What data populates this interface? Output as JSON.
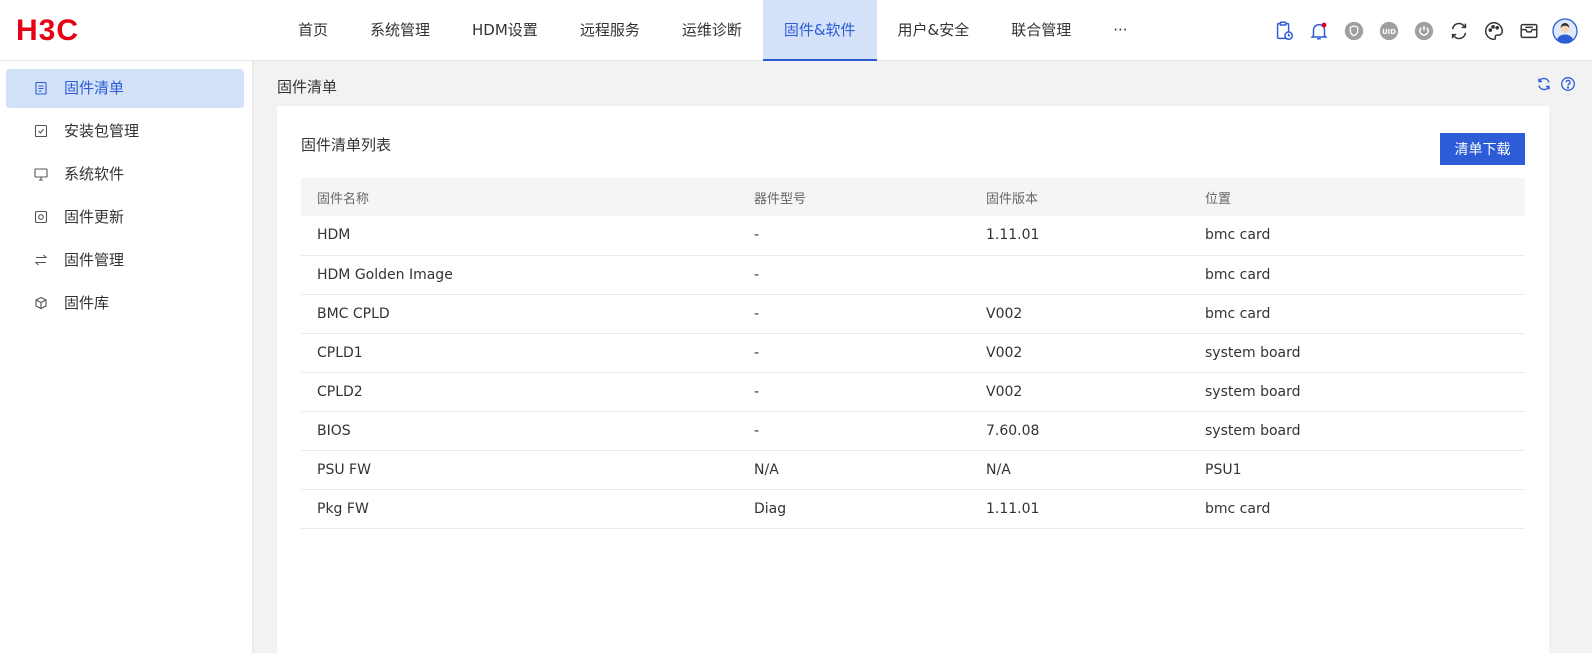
{
  "brand": {
    "logo_text": "H3C",
    "color": "#e60012",
    "accent": "#2d5cd6"
  },
  "nav": {
    "items": [
      {
        "label": "首页"
      },
      {
        "label": "系统管理"
      },
      {
        "label": "HDM设置"
      },
      {
        "label": "远程服务"
      },
      {
        "label": "运维诊断"
      },
      {
        "label": "固件&软件",
        "active": true
      },
      {
        "label": "用户&安全"
      },
      {
        "label": "联合管理"
      },
      {
        "label": "···"
      }
    ]
  },
  "header_icons": [
    "clipboard-clock-icon",
    "bell-icon",
    "shield-icon",
    "uid-icon",
    "power-icon",
    "refresh-user-icon",
    "palette-icon",
    "mail-icon",
    "avatar"
  ],
  "sidebar": {
    "items": [
      {
        "label": "固件清单",
        "icon": "clipboard-icon",
        "active": true
      },
      {
        "label": "安装包管理",
        "icon": "package-icon"
      },
      {
        "label": "系统软件",
        "icon": "monitor-icon"
      },
      {
        "label": "固件更新",
        "icon": "chip-icon"
      },
      {
        "label": "固件管理",
        "icon": "swap-icon"
      },
      {
        "label": "固件库",
        "icon": "cube-icon"
      }
    ]
  },
  "page": {
    "title": "固件清单"
  },
  "panel": {
    "title": "固件清单列表",
    "download_label": "清单下载",
    "columns": [
      "固件名称",
      "器件型号",
      "固件版本",
      "位置"
    ],
    "rows": [
      [
        "HDM",
        "-",
        "1.11.01",
        "bmc card"
      ],
      [
        "HDM Golden Image",
        "-",
        "",
        "bmc card"
      ],
      [
        "BMC CPLD",
        "-",
        "V002",
        "bmc card"
      ],
      [
        "CPLD1",
        "-",
        "V002",
        "system board"
      ],
      [
        "CPLD2",
        "-",
        "V002",
        "system board"
      ],
      [
        "BIOS",
        "-",
        "7.60.08",
        "system board"
      ],
      [
        "PSU FW",
        "N/A",
        "N/A",
        "PSU1"
      ],
      [
        "Pkg FW",
        "Diag",
        "1.11.01",
        "bmc card"
      ]
    ]
  }
}
